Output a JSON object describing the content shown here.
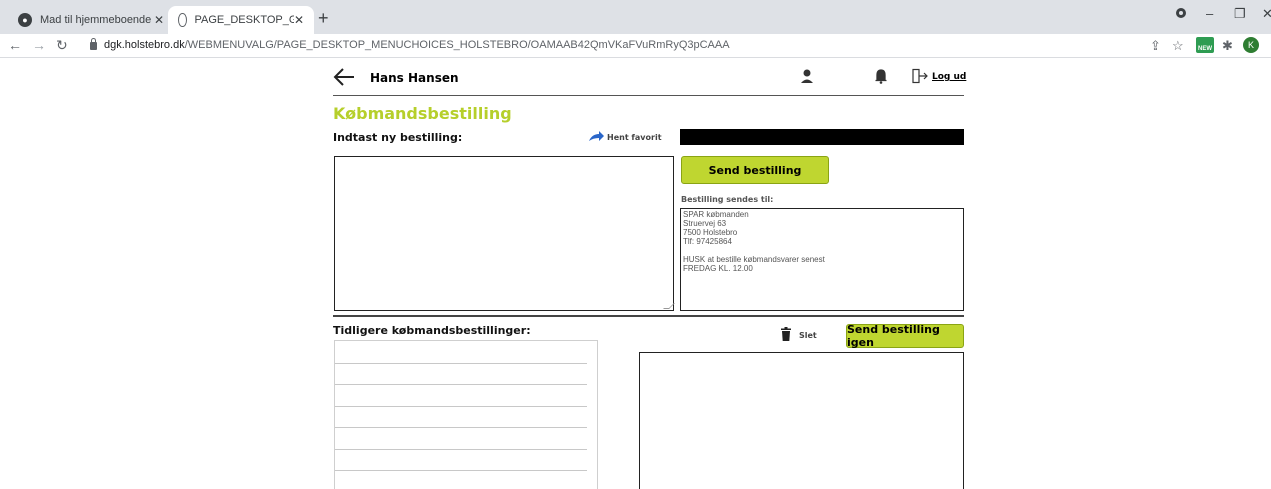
{
  "browser": {
    "tabs": [
      {
        "title": "Mad til hjemmeboende",
        "icon": "dark-app-icon"
      },
      {
        "title": "PAGE_DESKTOP_GROCERY_ORDI",
        "icon": "globe-icon"
      }
    ],
    "new_tab": "+",
    "url_host": "dgk.holstebro.dk",
    "url_path": "/WEBMENUVALG/PAGE_DESKTOP_MENUCHOICES_HOLSTEBRO/OAMAAB42QmVKaFVuRmRyQ3pCAAA",
    "new_badge": "NEW",
    "profile_initial": "K",
    "window_controls": [
      "–",
      "❐",
      "✕"
    ]
  },
  "header": {
    "user_name": "Hans Hansen",
    "logout_label": "Log ud"
  },
  "order": {
    "title": "Købmandsbestilling",
    "new_order_label": "Indtast ny bestilling:",
    "fetch_favorite_label": "Hent favorit",
    "order_text": "",
    "send_button_label": "Send bestilling",
    "recipient_label": "Bestilling sendes til:",
    "recipient_lines": [
      "SPAR købmanden",
      "Struervej 63",
      "7500 Holstebro",
      "Tlf: 97425864",
      "",
      "HUSK at bestille købmandsvarer senest",
      "FREDAG KL. 12.00"
    ]
  },
  "previous": {
    "label": "Tidligere købmandsbestillinger:",
    "delete_label": "Slet",
    "resend_button_label": "Send bestilling igen"
  },
  "colors": {
    "accent_green": "#bfd630",
    "title_green": "#b6cf2b"
  }
}
